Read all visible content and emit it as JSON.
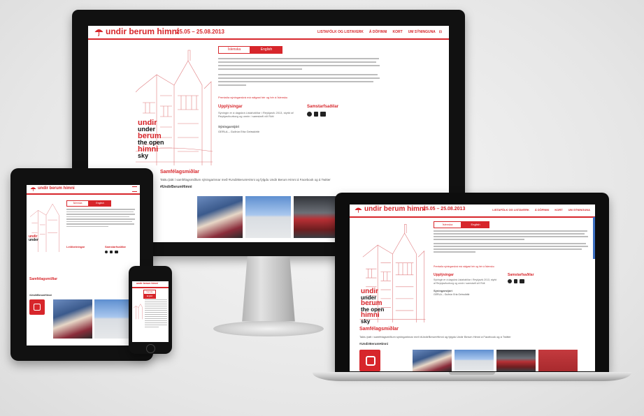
{
  "site": {
    "brand": "undir berum himni",
    "dates": "25.05 – 25.08.2013",
    "nav": [
      "LISTAFÓLK OG LISTAVERK",
      "Á DÖFINNI",
      "KORT",
      "UM SÝNINGUNA"
    ],
    "lang": {
      "is": "Íslenska",
      "en": "English"
    },
    "intro_link": "Prentaða sýningarskrá má nálgast hér og hér á Íslensku",
    "sections": {
      "opening": "Upplýsingar",
      "partners": "Samstarfsaðilar",
      "community": "Samfélagsmiðlar",
      "exhibitors": "Sýningarstjóri"
    },
    "opening_text": "Sýningin er á dagskrá Listahátíðar í Reykjavík 2013, styrkt af Reykjavíkurborg og unnin í samstarfi við Rótt",
    "curator": "GERLA – Guðrún Erla Geirsdóttir",
    "community_text": "Taktu þátt í samfélagsmiðlum sýningarinnar með #UndirBerumHimni og fylgdu Undir Berum Himni á Facebook og á Twitter",
    "facebook": "Facebook",
    "twitter": "Twitter",
    "hashtag": "#UndirBerumHimni",
    "title_art": [
      "undir",
      "under",
      "berum",
      "the open",
      "himni",
      "sky"
    ]
  },
  "tablet": {
    "nav_labels": [
      "Leiðbeiningar",
      "Samstarfsaðilar"
    ]
  },
  "colors": {
    "accent": "#d7262b",
    "bezel": "#111111",
    "text": "#666666"
  },
  "icons": [
    "umbrella-icon",
    "instagram-icon",
    "menu-icon",
    "social-icon"
  ]
}
